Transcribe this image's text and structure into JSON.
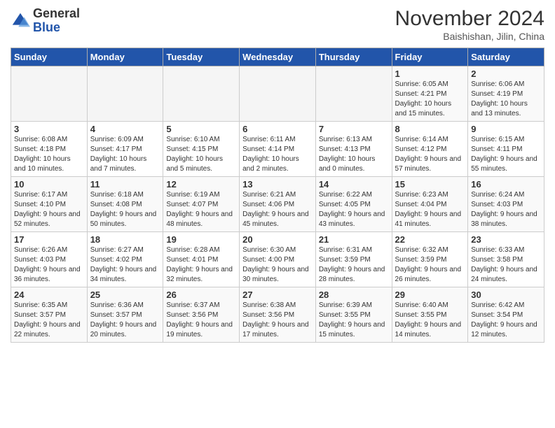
{
  "header": {
    "logo_line1": "General",
    "logo_line2": "Blue",
    "month_title": "November 2024",
    "location": "Baishishan, Jilin, China"
  },
  "weekdays": [
    "Sunday",
    "Monday",
    "Tuesday",
    "Wednesday",
    "Thursday",
    "Friday",
    "Saturday"
  ],
  "weeks": [
    [
      {
        "day": "",
        "sunrise": "",
        "sunset": "",
        "daylight": ""
      },
      {
        "day": "",
        "sunrise": "",
        "sunset": "",
        "daylight": ""
      },
      {
        "day": "",
        "sunrise": "",
        "sunset": "",
        "daylight": ""
      },
      {
        "day": "",
        "sunrise": "",
        "sunset": "",
        "daylight": ""
      },
      {
        "day": "",
        "sunrise": "",
        "sunset": "",
        "daylight": ""
      },
      {
        "day": "1",
        "sunrise": "Sunrise: 6:05 AM",
        "sunset": "Sunset: 4:21 PM",
        "daylight": "Daylight: 10 hours and 15 minutes."
      },
      {
        "day": "2",
        "sunrise": "Sunrise: 6:06 AM",
        "sunset": "Sunset: 4:19 PM",
        "daylight": "Daylight: 10 hours and 13 minutes."
      }
    ],
    [
      {
        "day": "3",
        "sunrise": "Sunrise: 6:08 AM",
        "sunset": "Sunset: 4:18 PM",
        "daylight": "Daylight: 10 hours and 10 minutes."
      },
      {
        "day": "4",
        "sunrise": "Sunrise: 6:09 AM",
        "sunset": "Sunset: 4:17 PM",
        "daylight": "Daylight: 10 hours and 7 minutes."
      },
      {
        "day": "5",
        "sunrise": "Sunrise: 6:10 AM",
        "sunset": "Sunset: 4:15 PM",
        "daylight": "Daylight: 10 hours and 5 minutes."
      },
      {
        "day": "6",
        "sunrise": "Sunrise: 6:11 AM",
        "sunset": "Sunset: 4:14 PM",
        "daylight": "Daylight: 10 hours and 2 minutes."
      },
      {
        "day": "7",
        "sunrise": "Sunrise: 6:13 AM",
        "sunset": "Sunset: 4:13 PM",
        "daylight": "Daylight: 10 hours and 0 minutes."
      },
      {
        "day": "8",
        "sunrise": "Sunrise: 6:14 AM",
        "sunset": "Sunset: 4:12 PM",
        "daylight": "Daylight: 9 hours and 57 minutes."
      },
      {
        "day": "9",
        "sunrise": "Sunrise: 6:15 AM",
        "sunset": "Sunset: 4:11 PM",
        "daylight": "Daylight: 9 hours and 55 minutes."
      }
    ],
    [
      {
        "day": "10",
        "sunrise": "Sunrise: 6:17 AM",
        "sunset": "Sunset: 4:10 PM",
        "daylight": "Daylight: 9 hours and 52 minutes."
      },
      {
        "day": "11",
        "sunrise": "Sunrise: 6:18 AM",
        "sunset": "Sunset: 4:08 PM",
        "daylight": "Daylight: 9 hours and 50 minutes."
      },
      {
        "day": "12",
        "sunrise": "Sunrise: 6:19 AM",
        "sunset": "Sunset: 4:07 PM",
        "daylight": "Daylight: 9 hours and 48 minutes."
      },
      {
        "day": "13",
        "sunrise": "Sunrise: 6:21 AM",
        "sunset": "Sunset: 4:06 PM",
        "daylight": "Daylight: 9 hours and 45 minutes."
      },
      {
        "day": "14",
        "sunrise": "Sunrise: 6:22 AM",
        "sunset": "Sunset: 4:05 PM",
        "daylight": "Daylight: 9 hours and 43 minutes."
      },
      {
        "day": "15",
        "sunrise": "Sunrise: 6:23 AM",
        "sunset": "Sunset: 4:04 PM",
        "daylight": "Daylight: 9 hours and 41 minutes."
      },
      {
        "day": "16",
        "sunrise": "Sunrise: 6:24 AM",
        "sunset": "Sunset: 4:03 PM",
        "daylight": "Daylight: 9 hours and 38 minutes."
      }
    ],
    [
      {
        "day": "17",
        "sunrise": "Sunrise: 6:26 AM",
        "sunset": "Sunset: 4:03 PM",
        "daylight": "Daylight: 9 hours and 36 minutes."
      },
      {
        "day": "18",
        "sunrise": "Sunrise: 6:27 AM",
        "sunset": "Sunset: 4:02 PM",
        "daylight": "Daylight: 9 hours and 34 minutes."
      },
      {
        "day": "19",
        "sunrise": "Sunrise: 6:28 AM",
        "sunset": "Sunset: 4:01 PM",
        "daylight": "Daylight: 9 hours and 32 minutes."
      },
      {
        "day": "20",
        "sunrise": "Sunrise: 6:30 AM",
        "sunset": "Sunset: 4:00 PM",
        "daylight": "Daylight: 9 hours and 30 minutes."
      },
      {
        "day": "21",
        "sunrise": "Sunrise: 6:31 AM",
        "sunset": "Sunset: 3:59 PM",
        "daylight": "Daylight: 9 hours and 28 minutes."
      },
      {
        "day": "22",
        "sunrise": "Sunrise: 6:32 AM",
        "sunset": "Sunset: 3:59 PM",
        "daylight": "Daylight: 9 hours and 26 minutes."
      },
      {
        "day": "23",
        "sunrise": "Sunrise: 6:33 AM",
        "sunset": "Sunset: 3:58 PM",
        "daylight": "Daylight: 9 hours and 24 minutes."
      }
    ],
    [
      {
        "day": "24",
        "sunrise": "Sunrise: 6:35 AM",
        "sunset": "Sunset: 3:57 PM",
        "daylight": "Daylight: 9 hours and 22 minutes."
      },
      {
        "day": "25",
        "sunrise": "Sunrise: 6:36 AM",
        "sunset": "Sunset: 3:57 PM",
        "daylight": "Daylight: 9 hours and 20 minutes."
      },
      {
        "day": "26",
        "sunrise": "Sunrise: 6:37 AM",
        "sunset": "Sunset: 3:56 PM",
        "daylight": "Daylight: 9 hours and 19 minutes."
      },
      {
        "day": "27",
        "sunrise": "Sunrise: 6:38 AM",
        "sunset": "Sunset: 3:56 PM",
        "daylight": "Daylight: 9 hours and 17 minutes."
      },
      {
        "day": "28",
        "sunrise": "Sunrise: 6:39 AM",
        "sunset": "Sunset: 3:55 PM",
        "daylight": "Daylight: 9 hours and 15 minutes."
      },
      {
        "day": "29",
        "sunrise": "Sunrise: 6:40 AM",
        "sunset": "Sunset: 3:55 PM",
        "daylight": "Daylight: 9 hours and 14 minutes."
      },
      {
        "day": "30",
        "sunrise": "Sunrise: 6:42 AM",
        "sunset": "Sunset: 3:54 PM",
        "daylight": "Daylight: 9 hours and 12 minutes."
      }
    ]
  ]
}
